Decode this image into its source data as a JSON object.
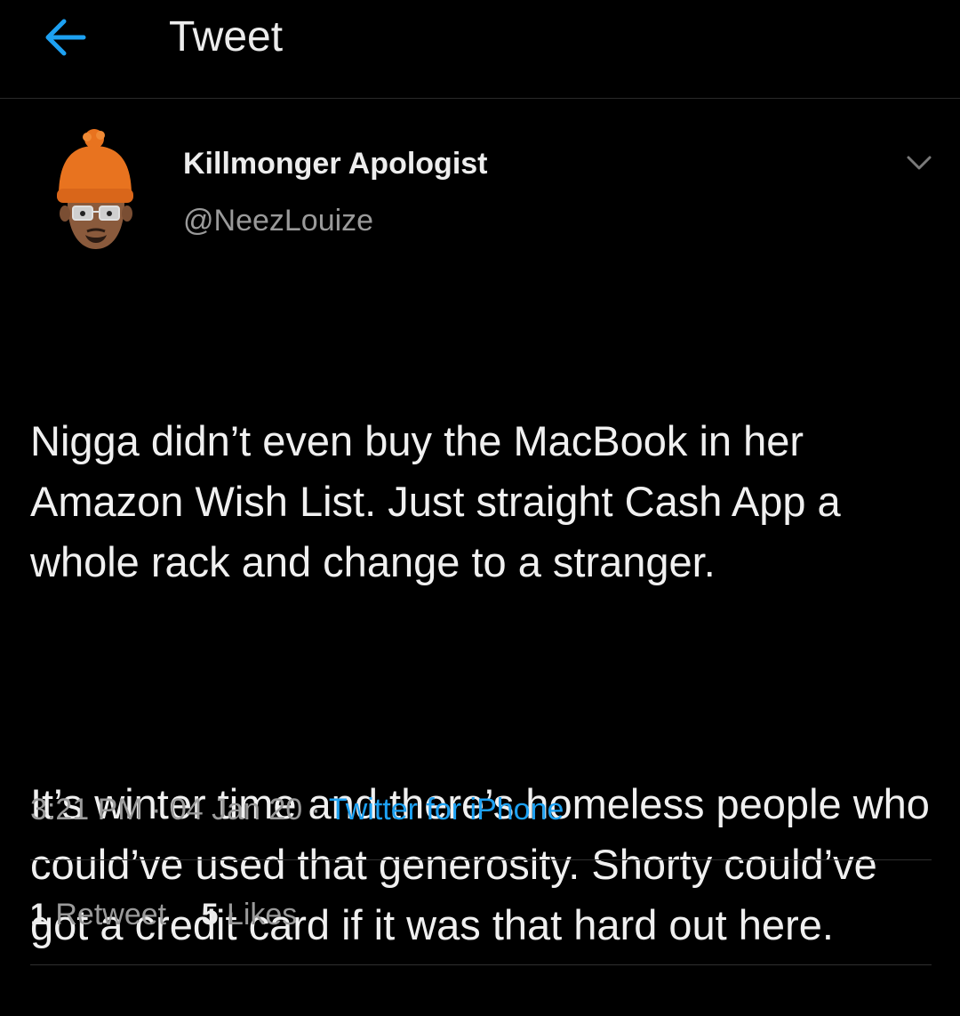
{
  "header": {
    "title": "Tweet",
    "back_icon": "arrow-left-icon",
    "accent_color": "#1da1f2"
  },
  "author": {
    "name": "Killmonger Apologist",
    "handle": "@NeezLouize",
    "avatar_icon": "memoji-avatar-orange-beanie"
  },
  "tweet": {
    "paragraph_1": "Nigga didn’t even buy the MacBook in her Amazon Wish List. Just straight Cash App a whole rack and change to a stranger.",
    "paragraph_2": "It’s winter time and there’s homeless people who could’ve used that generosity. Shorty could’ve got a credit card if it was that hard out here.",
    "time": "3:21 PM",
    "date": "04 Jan 20",
    "separator": "·",
    "source": "Twitter for iPhone"
  },
  "stats": {
    "retweets_count": "1",
    "retweets_label": "Retweet",
    "likes_count": "5",
    "likes_label": "Likes"
  },
  "colors": {
    "background": "#000000",
    "text": "#f0f0f0",
    "muted": "#9a9a9a",
    "link": "#1da1f2",
    "avatar_hat": "#e8731f"
  }
}
